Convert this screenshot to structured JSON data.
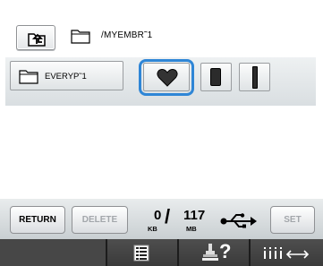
{
  "header": {
    "up_button_icon": "folder-up-icon",
    "current_path": "/MYEMBR˜1"
  },
  "folder_row": {
    "folder_name": "EVERYP˜1",
    "patterns": [
      {
        "icon": "heart-pattern-icon",
        "selected": true
      },
      {
        "icon": "rectangle-pattern-icon",
        "selected": false
      },
      {
        "icon": "bar-pattern-icon",
        "selected": false
      }
    ],
    "selection_color": "#2f86d6"
  },
  "toolbar": {
    "return_label": "RETURN",
    "delete_label": "DELETE",
    "set_label": "SET",
    "memory_used": "0",
    "memory_used_unit": "KB",
    "memory_total": "117",
    "memory_total_unit": "MB",
    "media_icon": "usb-icon"
  },
  "navbar": {
    "items": [
      {
        "icon": "list-icon"
      },
      {
        "icon": "help-icon",
        "text": "?"
      },
      {
        "icon": "thread-spacing-icon"
      }
    ]
  }
}
